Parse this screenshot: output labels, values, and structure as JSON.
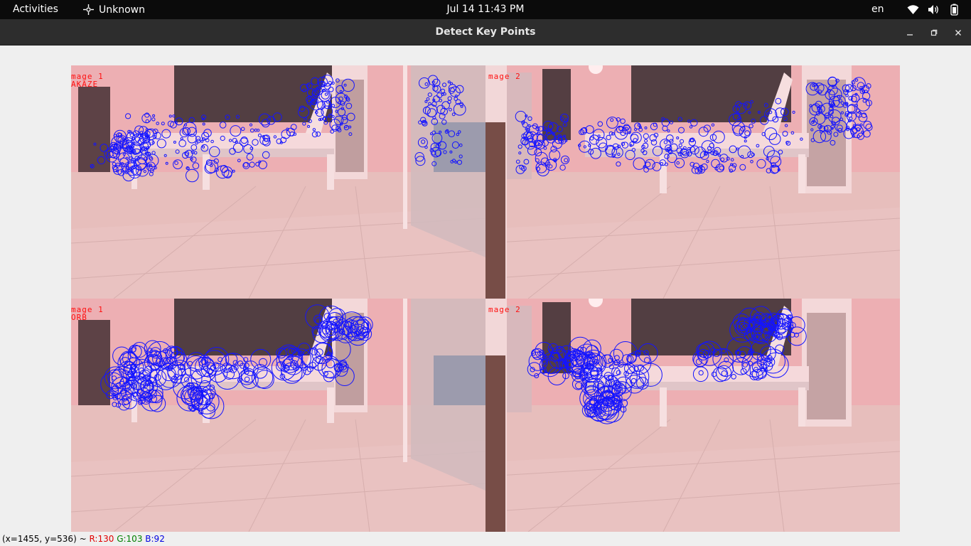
{
  "topbar": {
    "activities": "Activities",
    "app_name": "Unknown",
    "clock": "Jul 14  11:43 PM",
    "language": "en",
    "tray_icons": [
      "wifi-icon",
      "volume-icon",
      "battery-icon"
    ]
  },
  "window": {
    "title": "Detect Key Points",
    "controls": [
      "minimize",
      "maximize",
      "close"
    ]
  },
  "quadrants": [
    {
      "id": "top-left",
      "label_line1": "mage 1",
      "label_line2": "AKAZE"
    },
    {
      "id": "top-right",
      "label_line1": "mage 2",
      "label_line2": ""
    },
    {
      "id": "bottom-left",
      "label_line1": "mage 1",
      "label_line2": "ORB"
    },
    {
      "id": "bottom-right",
      "label_line1": "mage 2",
      "label_line2": ""
    }
  ],
  "status": {
    "coords": "(x=1455, y=536) ~",
    "r": "R:130",
    "g": "G:103",
    "b": "B:92"
  },
  "colors": {
    "keypoint": "#1414ff",
    "label": "#ff1010",
    "floor": "#e2c6c3",
    "wall": "#e9b3b6"
  }
}
